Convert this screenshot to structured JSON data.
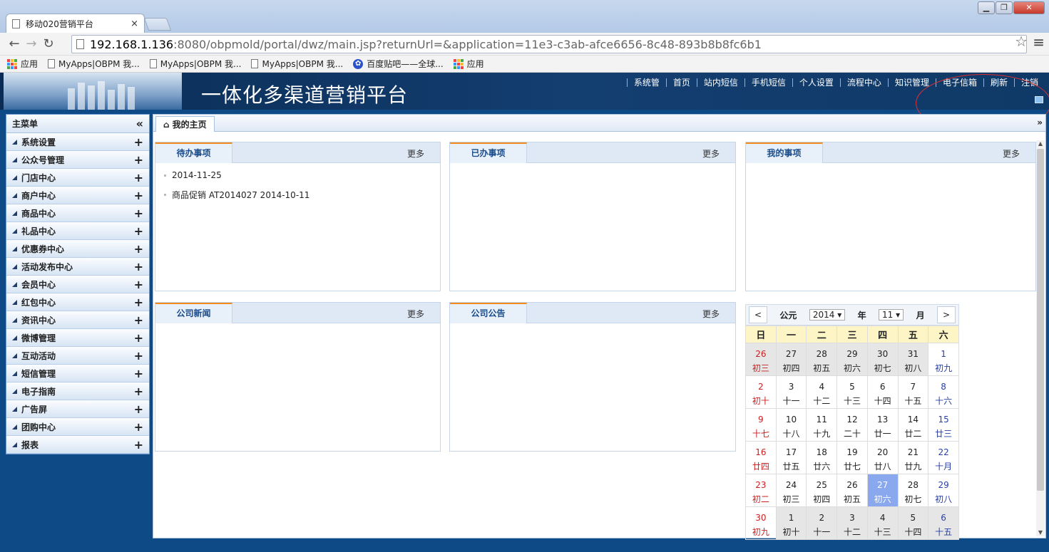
{
  "browser": {
    "tab_title": "移动020营销平台",
    "url_host": "192.168.1.136",
    "url_rest": ":8080/obpmold/portal/dwz/main.jsp?returnUrl=&application=11e3-c3ab-afce6656-8c48-893b8b8fc6b1",
    "bookmarks": [
      "应用",
      "MyApps|OBPM 我...",
      "MyApps|OBPM 我...",
      "MyApps|OBPM 我...",
      "百度贴吧——全球...",
      "应用"
    ]
  },
  "header": {
    "title": "一体化多渠道营销平台",
    "nav": [
      "系统管",
      "首页",
      "站内短信",
      "手机短信",
      "个人设置",
      "流程中心",
      "知识管理",
      "电子信箱",
      "刷新",
      "注销"
    ]
  },
  "sidebar": {
    "title": "主菜单",
    "collapse_glyph": "«",
    "items": [
      "系统设置",
      "公众号管理",
      "门店中心",
      "商户中心",
      "商品中心",
      "礼品中心",
      "优惠券中心",
      "活动发布中心",
      "会员中心",
      "红包中心",
      "资讯中心",
      "微博管理",
      "互动活动",
      "短信管理",
      "电子指南",
      "广告屏",
      "团购中心",
      "报表"
    ]
  },
  "main": {
    "home_tab": "我的主页",
    "more_label": "更多",
    "portlets": {
      "todo": {
        "title": "待办事项",
        "items": [
          "2014-11-25",
          "商品促销 AT2014027 2014-10-11"
        ]
      },
      "done": {
        "title": "已办事项"
      },
      "mine": {
        "title": "我的事项"
      },
      "news": {
        "title": "公司新闻"
      },
      "notice": {
        "title": "公司公告"
      }
    }
  },
  "calendar": {
    "era": "公元",
    "year": "2014",
    "year_unit": "年",
    "month": "11",
    "month_unit": "月",
    "prev": "<",
    "next": ">",
    "weekdays": [
      "日",
      "一",
      "二",
      "三",
      "四",
      "五",
      "六"
    ],
    "weeks": [
      [
        [
          "26",
          "初三"
        ],
        [
          "27",
          "初四"
        ],
        [
          "28",
          "初五"
        ],
        [
          "29",
          "初六"
        ],
        [
          "30",
          "初七"
        ],
        [
          "31",
          "初八"
        ],
        [
          "1",
          "初九"
        ]
      ],
      [
        [
          "2",
          "初十"
        ],
        [
          "3",
          "十一"
        ],
        [
          "4",
          "十二"
        ],
        [
          "5",
          "十三"
        ],
        [
          "6",
          "十四"
        ],
        [
          "7",
          "十五"
        ],
        [
          "8",
          "十六"
        ]
      ],
      [
        [
          "9",
          "十七"
        ],
        [
          "10",
          "十八"
        ],
        [
          "11",
          "十九"
        ],
        [
          "12",
          "二十"
        ],
        [
          "13",
          "廿一"
        ],
        [
          "14",
          "廿二"
        ],
        [
          "15",
          "廿三"
        ]
      ],
      [
        [
          "16",
          "廿四"
        ],
        [
          "17",
          "廿五"
        ],
        [
          "18",
          "廿六"
        ],
        [
          "19",
          "廿七"
        ],
        [
          "20",
          "廿八"
        ],
        [
          "21",
          "廿九"
        ],
        [
          "22",
          "十月"
        ]
      ],
      [
        [
          "23",
          "初二"
        ],
        [
          "24",
          "初三"
        ],
        [
          "25",
          "初四"
        ],
        [
          "26",
          "初五"
        ],
        [
          "27",
          "初六"
        ],
        [
          "28",
          "初七"
        ],
        [
          "29",
          "初八"
        ]
      ],
      [
        [
          "30",
          "初九"
        ],
        [
          "1",
          "初十"
        ],
        [
          "2",
          "十一"
        ],
        [
          "3",
          "十二"
        ],
        [
          "4",
          "十三"
        ],
        [
          "5",
          "十四"
        ],
        [
          "6",
          "十五"
        ]
      ]
    ]
  }
}
